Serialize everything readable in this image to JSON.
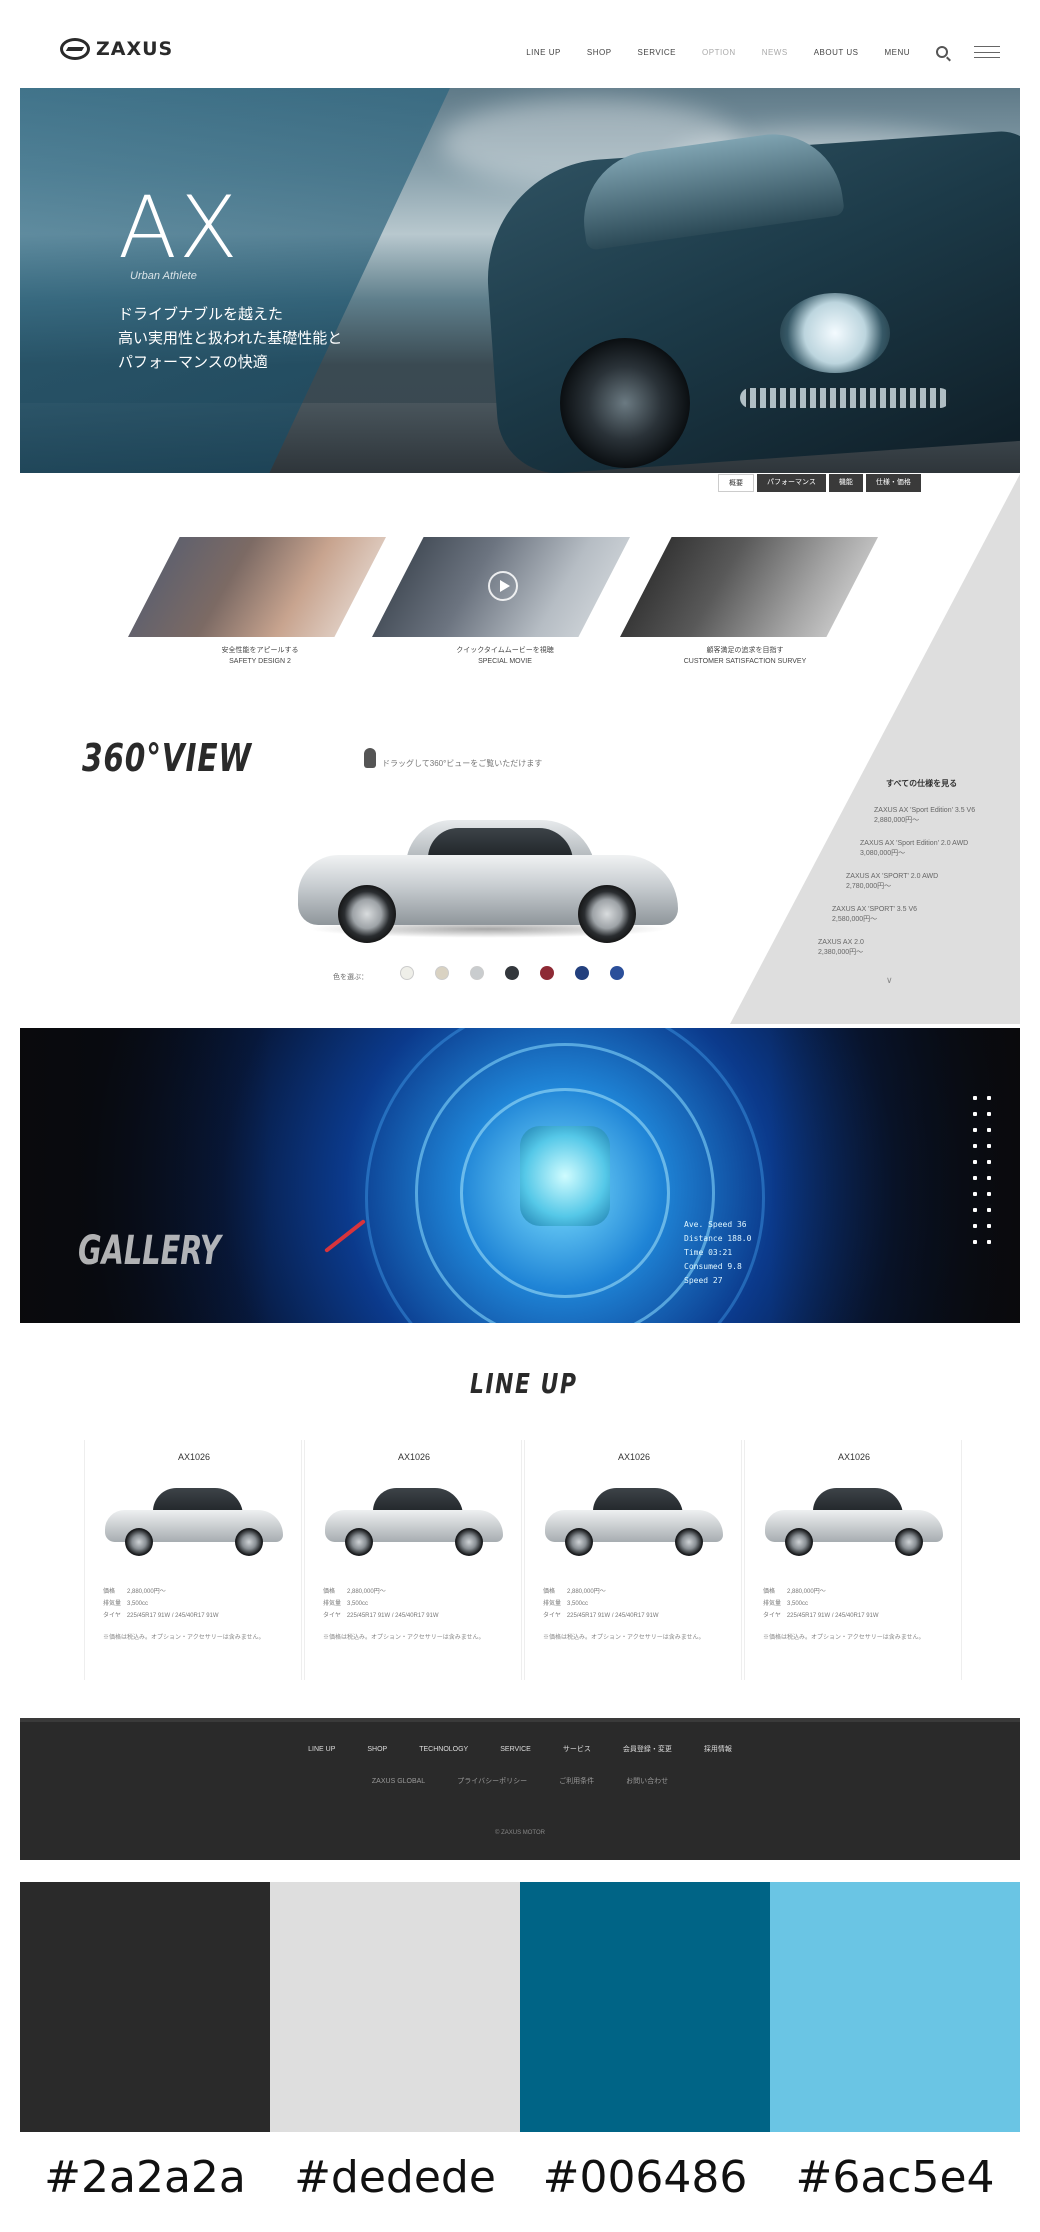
{
  "header": {
    "brand": "ZAXUS",
    "nav": [
      "LINE UP",
      "SHOP",
      "SERVICE",
      "OPTION",
      "NEWS",
      "ABOUT US",
      "MENU"
    ],
    "nav_muted": [
      false,
      false,
      false,
      true,
      true,
      false,
      false
    ]
  },
  "hero": {
    "title": "AX",
    "subtitle": "Urban Athlete",
    "copy": [
      "ドライブナブルを越えた",
      "高い実用性と扱われた基礎性能と",
      "パフォーマンスの快適"
    ],
    "tabs": [
      "概要",
      "パフォーマンス",
      "機能",
      "仕様・価格"
    ]
  },
  "features": [
    {
      "caption": [
        "安全性能をアピールする",
        "SAFETY DESIGN 2"
      ]
    },
    {
      "caption": [
        "クイックタイムムービーを視聴",
        "SPECIAL MOVIE"
      ]
    },
    {
      "caption": [
        "顧客満足の追求を目指す",
        "CUSTOMER SATISFACTION SURVEY"
      ]
    }
  ],
  "view360": {
    "title": "360°VIEW",
    "hint": "ドラッグして360°ビューをご覧いただけます",
    "color_label": "色を選ぶ：",
    "colors": [
      "#efefe9",
      "#d9d2c2",
      "#c9ccce",
      "#33373c",
      "#8e2a35",
      "#23407e",
      "#2b4f9a"
    ],
    "grades_title": "すべての仕様を見る",
    "grades": [
      [
        "ZAXUS AX 'Sport Edition' 3.5 V6",
        "2,880,000円〜"
      ],
      [
        "ZAXUS AX 'Sport Edition' 2.0 AWD",
        "3,080,000円〜"
      ],
      [
        "ZAXUS AX 'SPORT' 2.0 AWD",
        "2,780,000円〜"
      ],
      [
        "ZAXUS AX 'SPORT' 3.5 V6",
        "2,580,000円〜"
      ],
      [
        "ZAXUS AX 2.0",
        "2,380,000円〜"
      ]
    ]
  },
  "gallery": {
    "title": "GALLERY",
    "readout": [
      "Ave. Speed  36",
      "Distance  188.0",
      "Time  03:21",
      "Consumed  9.8",
      "Speed  27"
    ]
  },
  "lineup": {
    "title": "LINE UP",
    "cards": [
      {
        "name": "AX1026",
        "specs": [
          "価格　　2,880,000円〜",
          "排気量　3,500cc",
          "タイヤ　225/45R17 91W / 245/40R17 91W"
        ],
        "note": "※価格は税込み。オプション・アクセサリーは含みません。"
      },
      {
        "name": "AX1026",
        "specs": [
          "価格　　2,880,000円〜",
          "排気量　3,500cc",
          "タイヤ　225/45R17 91W / 245/40R17 91W"
        ],
        "note": "※価格は税込み。オプション・アクセサリーは含みません。"
      },
      {
        "name": "AX1026",
        "specs": [
          "価格　　2,880,000円〜",
          "排気量　3,500cc",
          "タイヤ　225/45R17 91W / 245/40R17 91W"
        ],
        "note": "※価格は税込み。オプション・アクセサリーは含みません。"
      },
      {
        "name": "AX1026",
        "specs": [
          "価格　　2,880,000円〜",
          "排気量　3,500cc",
          "タイヤ　225/45R17 91W / 245/40R17 91W"
        ],
        "note": "※価格は税込み。オプション・アクセサリーは含みません。"
      }
    ]
  },
  "footer": {
    "row1": [
      "LINE UP",
      "SHOP",
      "TECHNOLOGY",
      "SERVICE",
      "サービス",
      "会員登録・変更",
      "採用情報"
    ],
    "row2": [
      "ZAXUS GLOBAL",
      "プライバシーポリシー",
      "ご利用条件",
      "お問い合わせ"
    ],
    "copyright": "© ZAXUS MOTOR"
  },
  "palette": [
    {
      "hex": "#2a2a2a",
      "label": "#2a2a2a"
    },
    {
      "hex": "#dedede",
      "label": "#dedede"
    },
    {
      "hex": "#006486",
      "label": "#006486"
    },
    {
      "hex": "#6ac5e4",
      "label": "#6ac5e4"
    }
  ]
}
